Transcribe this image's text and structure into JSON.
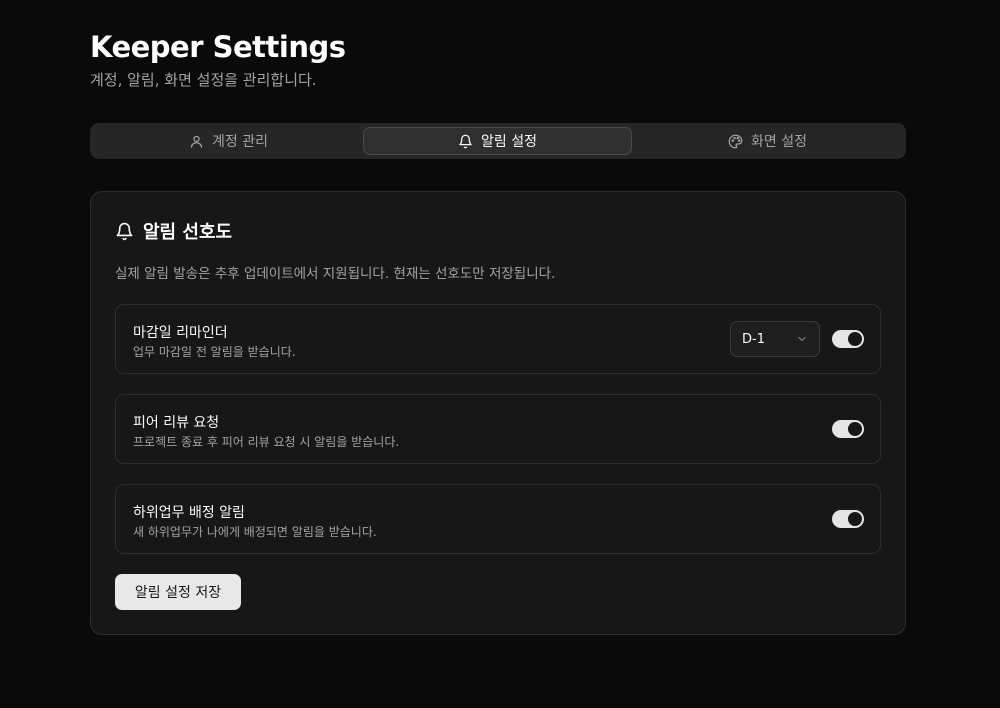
{
  "header": {
    "title": "Keeper Settings",
    "subtitle": "계정, 알림, 화면 설정을 관리합니다."
  },
  "tabs": [
    {
      "label": "계정 관리",
      "icon": "user-icon",
      "active": false
    },
    {
      "label": "알림 설정",
      "icon": "bell-icon",
      "active": true
    },
    {
      "label": "화면 설정",
      "icon": "palette-icon",
      "active": false
    }
  ],
  "card": {
    "title": "알림 선호도",
    "icon": "bell-icon",
    "description": "실제 알림 발송은 추후 업데이트에서 지원됩니다. 현재는 선호도만 저장됩니다.",
    "rows": [
      {
        "label": "마감일 리마인더",
        "help": "업무 마감일 전 알림을 받습니다.",
        "select_value": "D-1",
        "enabled": true
      },
      {
        "label": "피어 리뷰 요청",
        "help": "프로젝트 종료 후 피어 리뷰 요청 시 알림을 받습니다.",
        "enabled": true
      },
      {
        "label": "하위업무 배정 알림",
        "help": "새 하위업무가 나에게 배정되면 알림을 받습니다.",
        "enabled": true
      }
    ],
    "save_label": "알림 설정 저장"
  },
  "colors": {
    "background": "#0a0a0a",
    "card": "#171717",
    "border": "#2e2e2e",
    "text": "#fafafa",
    "muted": "#a3a3a3",
    "toggle_on": "#e5e5e5"
  }
}
